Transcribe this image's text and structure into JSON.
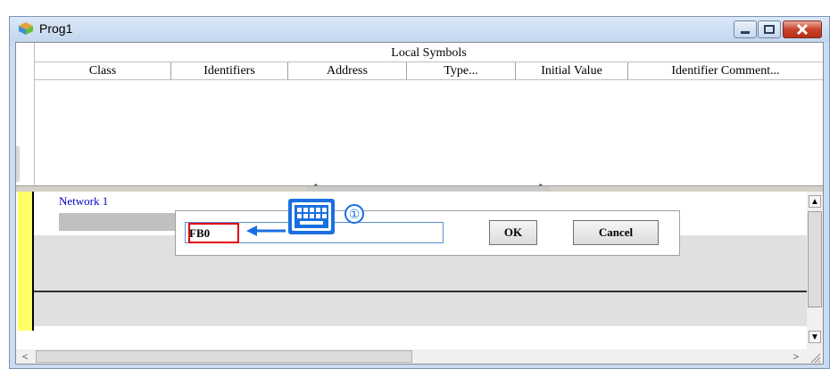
{
  "window": {
    "title": "Prog1",
    "icon": "cube-app-icon"
  },
  "title_buttons": {
    "minimize": "minimize-icon",
    "maximize": "maximize-icon",
    "close": "close-icon"
  },
  "symbols_table": {
    "header": "Local Symbols",
    "columns": [
      "Class",
      "Identifiers",
      "Address",
      "Type...",
      "Initial Value",
      "Identifier Comment..."
    ]
  },
  "network": {
    "label": "Network 1"
  },
  "dialog": {
    "input_value": "FB0",
    "ok_label": "OK",
    "cancel_label": "Cancel"
  },
  "annotation": {
    "step_number": "①",
    "icon": "keyboard-icon",
    "accent_color": "#1a6fe0",
    "highlight_color": "#e00000"
  },
  "scrollbars": {
    "left_arrow": "<",
    "right_arrow": ">",
    "up_arrow": "▲",
    "down_arrow": "▼"
  }
}
